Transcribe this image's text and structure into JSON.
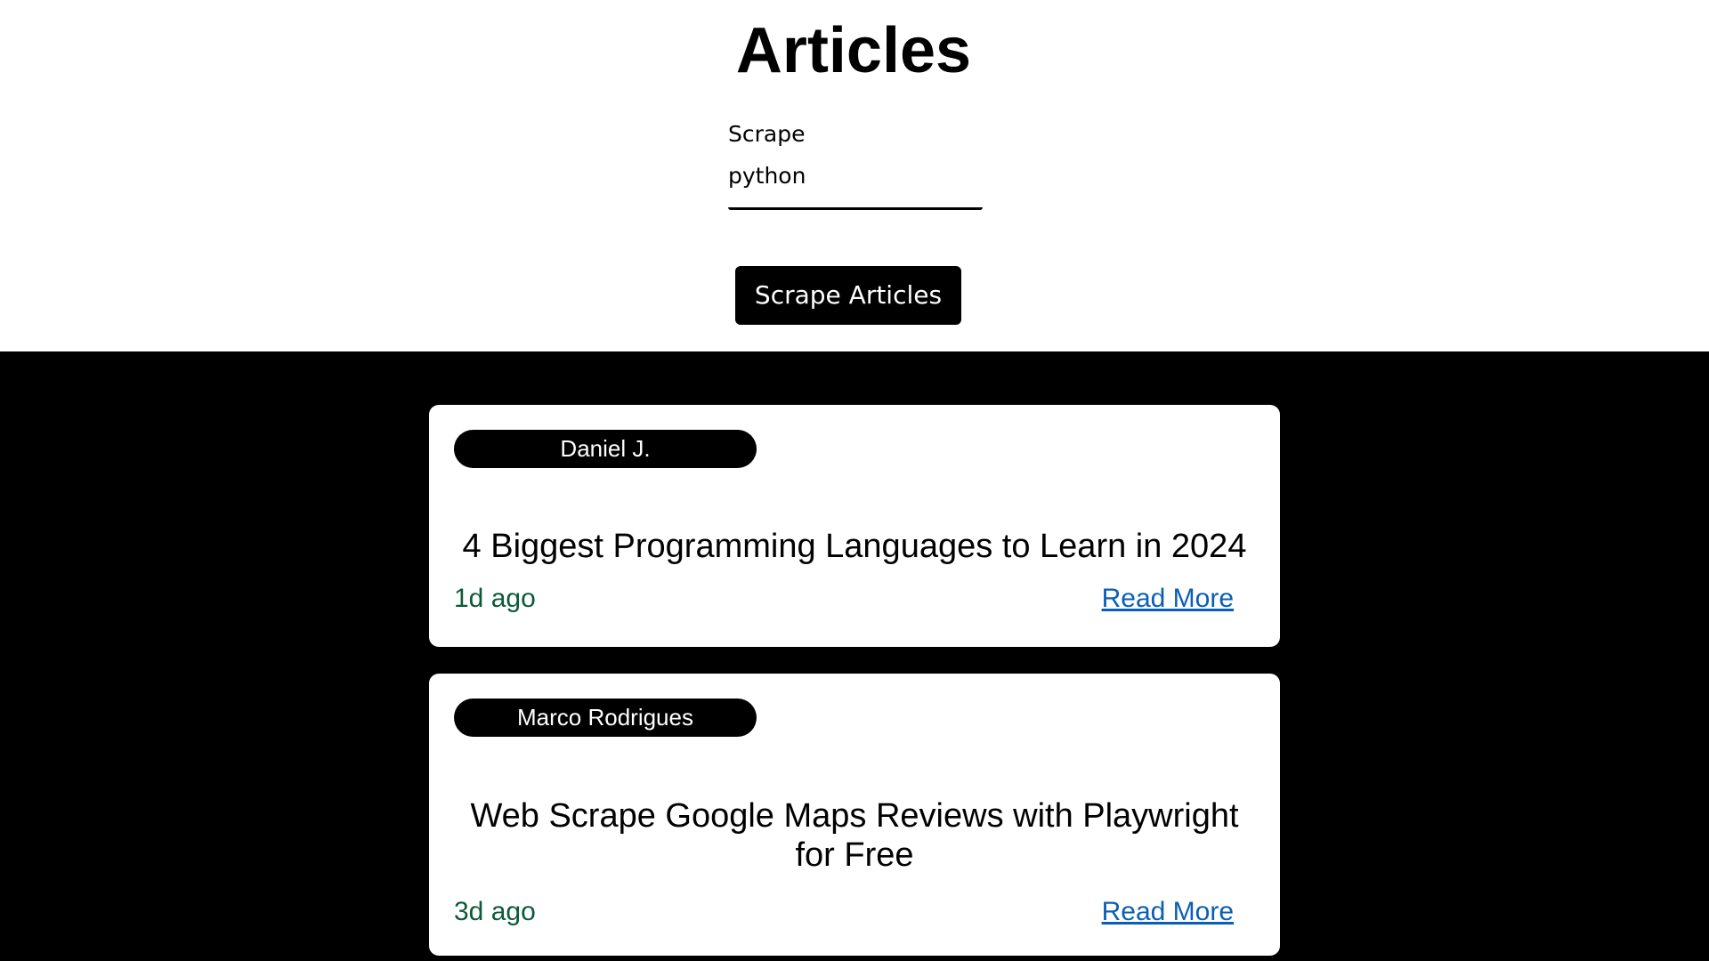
{
  "header": {
    "title": "Articles",
    "field_label": "Scrape",
    "search_value": "python",
    "button_label": "Scrape Articles"
  },
  "articles": [
    {
      "author": "Daniel J.",
      "title": "4 Biggest Programming Languages to Learn in 2024",
      "time": "1d ago",
      "link_label": "Read More"
    },
    {
      "author": "Marco Rodrigues",
      "title": "Web Scrape Google Maps Reviews with Playwright for Free",
      "time": "3d ago",
      "link_label": "Read More"
    }
  ],
  "colors": {
    "page_background": "#ffffff",
    "results_background": "#000000",
    "card_background": "#ffffff",
    "badge_background": "#000000",
    "time_text": "#0b5a3a",
    "link_text": "#0a5fb4"
  }
}
